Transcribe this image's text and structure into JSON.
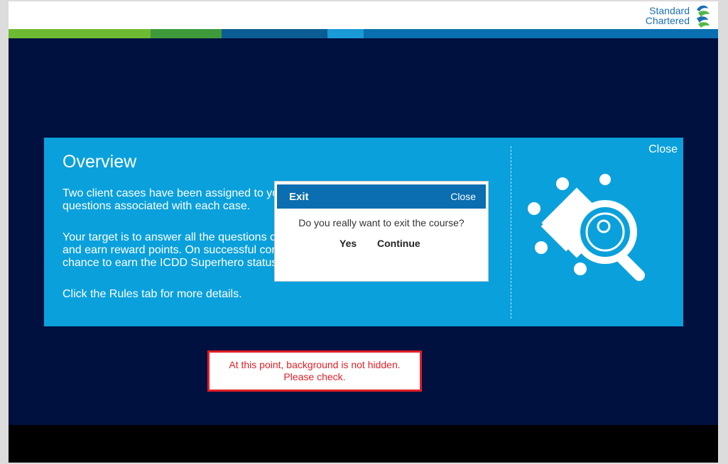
{
  "brand": {
    "line1": "Standard",
    "line2": "Chartered"
  },
  "overview": {
    "title": "Overview",
    "close_label": "Close",
    "para1": "Two client cases have been assigned to you. Answer the questions associated with each case.",
    "para1_line1": "Two client cases have been assigned to yo",
    "para1_line2": "questions associated with each case.",
    "para2_line1": "Your target is to answer all the questions c",
    "para2_line2": "and earn reward points. On successful cor",
    "para2_line3": "chance to earn the ICDD Superhero status",
    "para3": "Click the Rules tab for more details."
  },
  "exit_dialog": {
    "title": "Exit",
    "close_label": "Close",
    "message": "Do you really want to exit the course?",
    "yes_label": "Yes",
    "continue_label": "Continue"
  },
  "annotation": {
    "line1": "At this point, background is not hidden.",
    "line2": "Please check."
  },
  "colors": {
    "background": "#00103f",
    "panel": "#0aa0dc",
    "dialog_header": "#0a6eb0",
    "annotation_border": "#e21f26"
  },
  "icons": {
    "puzzle": "puzzle-magnifier-icon",
    "logo": "standard-chartered-logo-icon"
  }
}
